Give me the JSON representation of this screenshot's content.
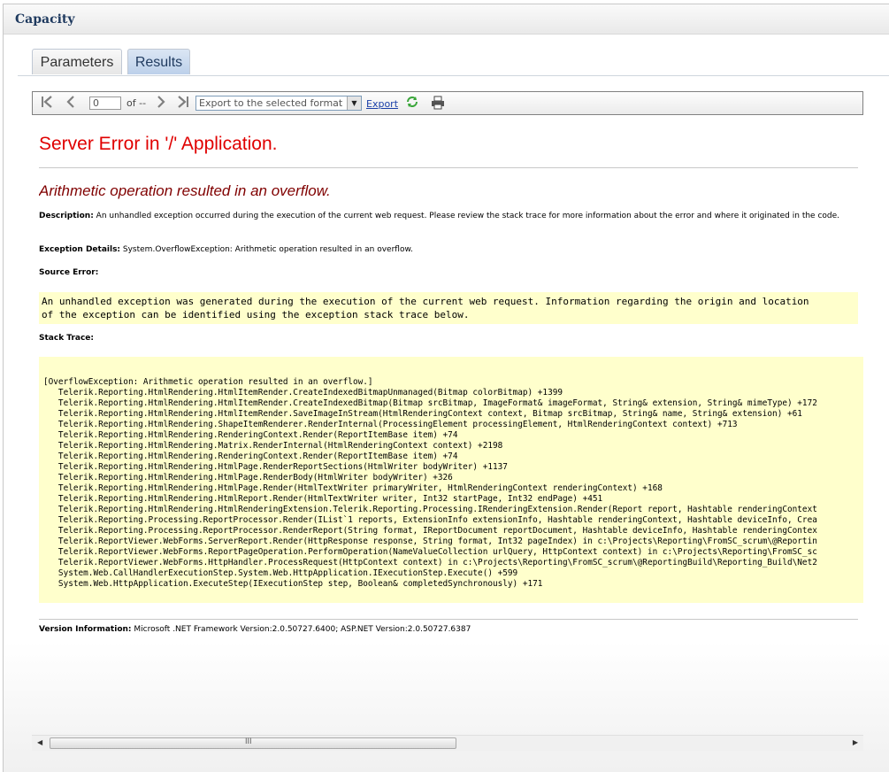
{
  "window": {
    "title": "Capacity"
  },
  "tabs": [
    {
      "label": "Parameters",
      "active": false
    },
    {
      "label": "Results",
      "active": true
    }
  ],
  "toolbar": {
    "icons": [
      "first-page-icon",
      "previous-page-icon",
      "next-page-icon",
      "last-page-icon",
      "refresh-icon",
      "print-icon"
    ],
    "page_value": "0",
    "of_pages": "of --",
    "export_select_value": "Export to the selected format",
    "export_label": "Export"
  },
  "error": {
    "heading": "Server Error in '/' Application.",
    "message": "Arithmetic operation resulted in an overflow.",
    "description_label": "Description:",
    "description_text": " An unhandled exception occurred during the execution of the current web request. Please review the stack trace for more information about the error and where it originated in the code.",
    "exception_label": "Exception Details:",
    "exception_text": " System.OverflowException: Arithmetic operation resulted in an overflow.",
    "source_error_label": "Source Error:",
    "source_error_text": "An unhandled exception was generated during the execution of the current web request. Information regarding the origin and location\nof the exception can be identified using the exception stack trace below.",
    "stack_trace_label": "Stack Trace:",
    "stack_trace_text": "[OverflowException: Arithmetic operation resulted in an overflow.]\n   Telerik.Reporting.HtmlRendering.HtmlItemRender.CreateIndexedBitmapUnmanaged(Bitmap colorBitmap) +1399\n   Telerik.Reporting.HtmlRendering.HtmlItemRender.CreateIndexedBitmap(Bitmap srcBitmap, ImageFormat& imageFormat, String& extension, String& mimeType) +172\n   Telerik.Reporting.HtmlRendering.HtmlItemRender.SaveImageInStream(HtmlRenderingContext context, Bitmap srcBitmap, String& name, String& extension) +61\n   Telerik.Reporting.HtmlRendering.ShapeItemRenderer.RenderInternal(ProcessingElement processingElement, HtmlRenderingContext context) +713\n   Telerik.Reporting.HtmlRendering.RenderingContext.Render(ReportItemBase item) +74\n   Telerik.Reporting.HtmlRendering.Matrix.RenderInternal(HtmlRenderingContext context) +2198\n   Telerik.Reporting.HtmlRendering.RenderingContext.Render(ReportItemBase item) +74\n   Telerik.Reporting.HtmlRendering.HtmlPage.RenderReportSections(HtmlWriter bodyWriter) +1137\n   Telerik.Reporting.HtmlRendering.HtmlPage.RenderBody(HtmlWriter bodyWriter) +326\n   Telerik.Reporting.HtmlRendering.HtmlPage.Render(HtmlTextWriter primaryWriter, HtmlRenderingContext renderingContext) +168\n   Telerik.Reporting.HtmlRendering.HtmlReport.Render(HtmlTextWriter writer, Int32 startPage, Int32 endPage) +451\n   Telerik.Reporting.HtmlRendering.HtmlRenderingExtension.Telerik.Reporting.Processing.IRenderingExtension.Render(Report report, Hashtable renderingContext\n   Telerik.Reporting.Processing.ReportProcessor.Render(IList`1 reports, ExtensionInfo extensionInfo, Hashtable renderingContext, Hashtable deviceInfo, Crea\n   Telerik.Reporting.Processing.ReportProcessor.RenderReport(String format, IReportDocument reportDocument, Hashtable deviceInfo, Hashtable renderingContex\n   Telerik.ReportViewer.WebForms.ServerReport.Render(HttpResponse response, String format, Int32 pageIndex) in c:\\Projects\\Reporting\\FromSC_scrum\\@Reportin\n   Telerik.ReportViewer.WebForms.ReportPageOperation.PerformOperation(NameValueCollection urlQuery, HttpContext context) in c:\\Projects\\Reporting\\FromSC_sc\n   Telerik.ReportViewer.WebForms.HttpHandler.ProcessRequest(HttpContext context) in c:\\Projects\\Reporting\\FromSC_scrum\\@ReportingBuild\\Reporting_Build\\Net2\n   System.Web.CallHandlerExecutionStep.System.Web.HttpApplication.IExecutionStep.Execute() +599\n   System.Web.HttpApplication.ExecuteStep(IExecutionStep step, Boolean& completedSynchronously) +171",
    "version_label": "Version Information:",
    "version_text": " Microsoft .NET Framework Version:2.0.50727.6400; ASP.NET Version:2.0.50727.6387"
  },
  "scrollbar": {
    "grip": "III"
  },
  "colors": {
    "error_heading": "#e00000",
    "error_message": "#800000",
    "highlight_box": "#ffffcc",
    "active_tab": "#bcd0ea",
    "link": "#1a3fa8"
  }
}
